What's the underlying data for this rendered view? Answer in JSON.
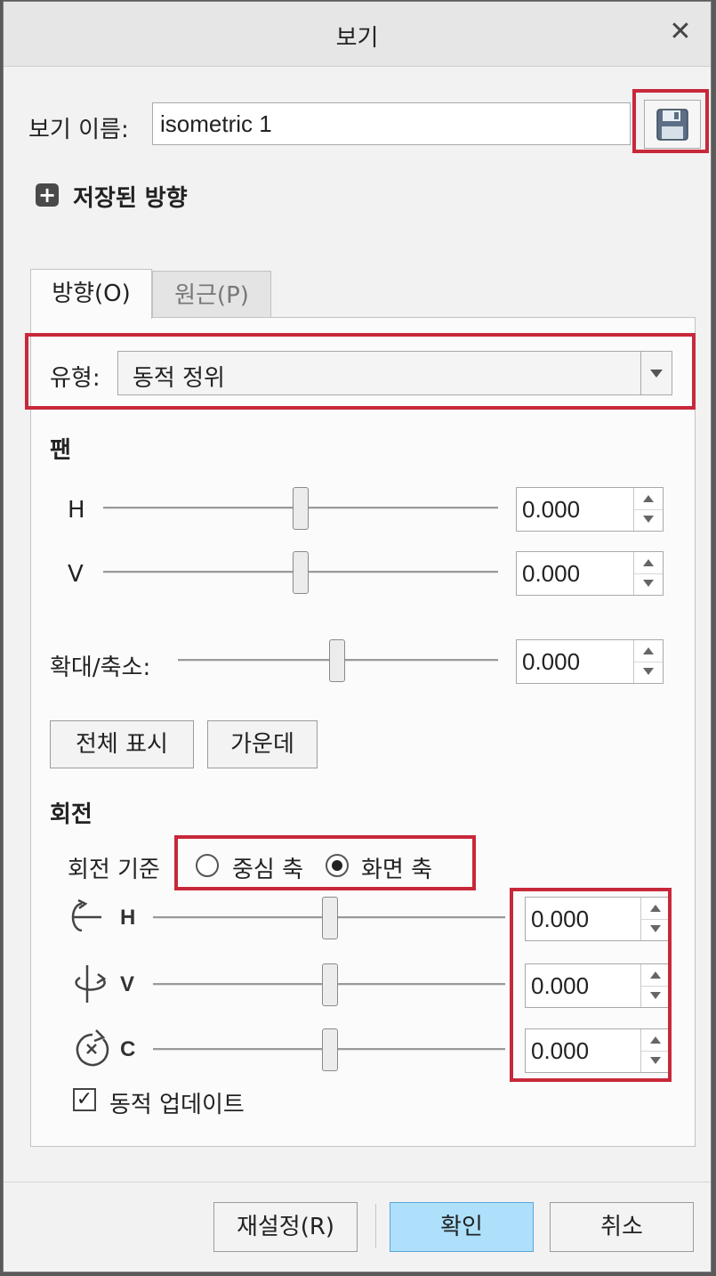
{
  "dialog": {
    "title": "보기"
  },
  "view_name": {
    "label": "보기 이름:",
    "value": "isometric 1"
  },
  "saved_orientations": {
    "label": "저장된 방향"
  },
  "tabs": [
    {
      "label": "방향(O)",
      "active": true
    },
    {
      "label": "원근(P)",
      "active": false
    }
  ],
  "type": {
    "label": "유형:",
    "value": "동적 정위"
  },
  "pan": {
    "title": "팬",
    "h": {
      "label": "H",
      "value": "0.000",
      "level": 0.5
    },
    "v": {
      "label": "V",
      "value": "0.000",
      "level": 0.5
    }
  },
  "zoom": {
    "label": "확대/축소:",
    "value": "0.000",
    "level": 0.5
  },
  "buttons": {
    "fit_all": "전체 표시",
    "center": "가운데"
  },
  "rotation": {
    "title": "회전",
    "basis_label": "회전 기준",
    "options": [
      {
        "label": "중심 축",
        "selected": false
      },
      {
        "label": "화면 축",
        "selected": true
      }
    ],
    "h": {
      "label": "H",
      "value": "0.000",
      "level": 0.5
    },
    "v": {
      "label": "V",
      "value": "0.000",
      "level": 0.5
    },
    "c": {
      "label": "C",
      "value": "0.000",
      "level": 0.5
    }
  },
  "dynamic_update": {
    "label": "동적 업데이트",
    "checked": true
  },
  "footer": {
    "reset": "재설정(R)",
    "ok": "확인",
    "cancel": "취소"
  },
  "colors": {
    "highlight": "#c8283a",
    "primary_button": "#aee0fb"
  }
}
